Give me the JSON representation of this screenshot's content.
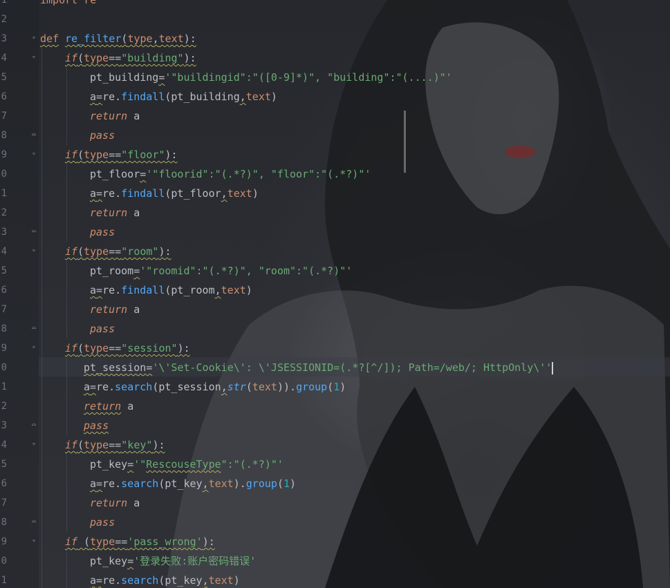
{
  "editor": {
    "line_numbers": [
      "1",
      "2",
      "3",
      "4",
      "5",
      "6",
      "7",
      "8",
      "9",
      "0",
      "1",
      "2",
      "3",
      "4",
      "5",
      "6",
      "7",
      "8",
      "9",
      "0",
      "1",
      "2",
      "3",
      "4",
      "5",
      "6",
      "7",
      "8",
      "9",
      "0",
      "1"
    ],
    "lines": {
      "l1": {
        "t0": "import re"
      },
      "l3": {
        "t0": "def",
        "t1": " ",
        "t2": "re_filter",
        "t3": "(",
        "t4": "type",
        "t5": ",",
        "t6": "text",
        "t7": "):"
      },
      "l4": {
        "t0": "if",
        "t1": "(",
        "t2": "type",
        "t3": "==",
        "t4": "\"building\"",
        "t5": "):"
      },
      "l5": {
        "t0": "pt_building",
        "t1": "=",
        "t2": "'\"buildingid\":\"([0-9]*)\", \"building\":\"(....)\"'"
      },
      "l6": {
        "t0": "a",
        "t1": "=",
        "t2": "re.",
        "t3": "findall",
        "t4": "(pt_building",
        "t5": ",",
        "t6": "text",
        "t7": ")"
      },
      "l7": {
        "t0": "return",
        "t1": " a"
      },
      "l8": {
        "t0": "pass"
      },
      "l9": {
        "t0": "if",
        "t1": "(",
        "t2": "type",
        "t3": "==",
        "t4": "\"floor\"",
        "t5": "):"
      },
      "l10": {
        "t0": "pt_floor",
        "t1": "=",
        "t2": "'\"floorid\":\"(.*?)\", \"floor\":\"(.*?)\"'"
      },
      "l11": {
        "t0": "a",
        "t1": "=",
        "t2": "re.",
        "t3": "findall",
        "t4": "(pt_floor",
        "t5": ",",
        "t6": "text",
        "t7": ")"
      },
      "l12": {
        "t0": "return",
        "t1": " a"
      },
      "l13": {
        "t0": "pass"
      },
      "l14": {
        "t0": "if",
        "t1": "(",
        "t2": "type",
        "t3": "==",
        "t4": "\"room\"",
        "t5": "):"
      },
      "l15": {
        "t0": "pt_room",
        "t1": "=",
        "t2": "'\"roomid\":\"(.*?)\", \"room\":\"(.*?)\"'"
      },
      "l16": {
        "t0": "a",
        "t1": "=",
        "t2": "re.",
        "t3": "findall",
        "t4": "(pt_room",
        "t5": ",",
        "t6": "text",
        "t7": ")"
      },
      "l17": {
        "t0": "return",
        "t1": " a"
      },
      "l18": {
        "t0": "pass"
      },
      "l19": {
        "t0": "if",
        "t1": "(",
        "t2": "type",
        "t3": "==",
        "t4": "\"session\"",
        "t5": "):"
      },
      "l20": {
        "t0": "pt_session",
        "t1": "=",
        "t2": "'\\'Set-Cookie\\': \\'JSESSIONID=(.*?[^/]); Path=/web/; HttpOnly\\''"
      },
      "l21": {
        "t0": "a",
        "t1": "=",
        "t2": "re.",
        "t3": "search",
        "t4": "(pt_session",
        "t5": ",",
        "t6": "str",
        "t7": "(",
        "t8": "text",
        "t9": ")).",
        "t10": "group",
        "t11": "(",
        "t12": "1",
        "t13": ")"
      },
      "l22": {
        "t0": "return",
        "t1": " a"
      },
      "l23": {
        "t0": "pass"
      },
      "l24": {
        "t0": "if",
        "t1": "(",
        "t2": "type",
        "t3": "==",
        "t4": "\"key\"",
        "t5": "):"
      },
      "l25": {
        "t0": "pt_key",
        "t1": "=",
        "t2": "'\"",
        "t3": "RescouseType",
        "t4": "\":\"(.*?)\"'"
      },
      "l26": {
        "t0": "a",
        "t1": "=",
        "t2": "re.",
        "t3": "search",
        "t4": "(pt_key",
        "t5": ",",
        "t6": "text",
        "t7": ").",
        "t8": "group",
        "t9": "(",
        "t10": "1",
        "t11": ")"
      },
      "l27": {
        "t0": "return",
        "t1": " a"
      },
      "l28": {
        "t0": "pass"
      },
      "l29": {
        "t0": "if",
        "t1": " (",
        "t2": "type",
        "t3": "==",
        "t4": "'pass_wrong'",
        "t5": "):"
      },
      "l30": {
        "t0": "pt_key",
        "t1": "=",
        "t2": "'登录失败:账户密码错误'"
      },
      "l31": {
        "t0": "a",
        "t1": "=",
        "t2": "re.",
        "t3": "search",
        "t4": "(pt_key",
        "t5": ",",
        "t6": "text",
        "t7": ")"
      }
    }
  },
  "colors": {
    "keyword": "#cf8e6d",
    "function": "#56a8f5",
    "string": "#6aab73",
    "number": "#2aacb8",
    "identifier": "#bcbec4",
    "line_number": "#6f737a"
  }
}
